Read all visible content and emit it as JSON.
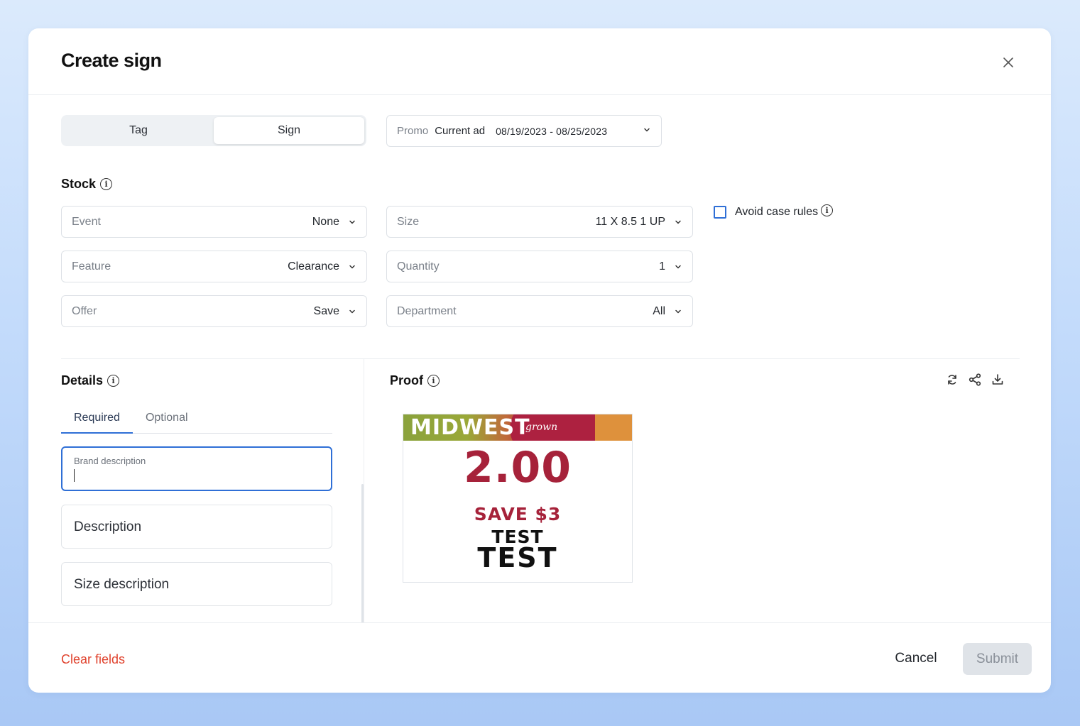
{
  "modal": {
    "title": "Create sign"
  },
  "toggle": {
    "tag_label": "Tag",
    "sign_label": "Sign",
    "selected": "Sign"
  },
  "promo": {
    "label": "Promo",
    "value": "Current ad",
    "dates": "08/19/2023 - 08/25/2023"
  },
  "stock": {
    "title": "Stock",
    "event": {
      "label": "Event",
      "value": "None"
    },
    "feature": {
      "label": "Feature",
      "value": "Clearance"
    },
    "offer": {
      "label": "Offer",
      "value": "Save"
    },
    "size": {
      "label": "Size",
      "value": "11 X 8.5 1 UP"
    },
    "quantity": {
      "label": "Quantity",
      "value": "1"
    },
    "department": {
      "label": "Department",
      "value": "All"
    },
    "avoid_case_rules": {
      "label": "Avoid case rules",
      "checked": false
    }
  },
  "details": {
    "title": "Details",
    "tabs": [
      "Required",
      "Optional"
    ],
    "active_tab": "Required",
    "fields": {
      "brand_description": {
        "label": "Brand description",
        "value": ""
      },
      "description": {
        "placeholder": "Description"
      },
      "size_description": {
        "placeholder": "Size description"
      }
    }
  },
  "proof": {
    "title": "Proof",
    "actions": [
      "refresh-icon",
      "share-icon",
      "download-icon"
    ],
    "sign": {
      "brand": "MIDWEST",
      "brand_sub": "grown",
      "price": "2.00",
      "save_text": "SAVE $3",
      "line1": "TEST",
      "line2": "TEST",
      "price_color": "#a6223a"
    }
  },
  "footer": {
    "clear_label": "Clear fields",
    "cancel_label": "Cancel",
    "submit_label": "Submit",
    "submit_enabled": false
  },
  "colors": {
    "accent": "#2f6fd6",
    "danger": "#e0432e"
  }
}
